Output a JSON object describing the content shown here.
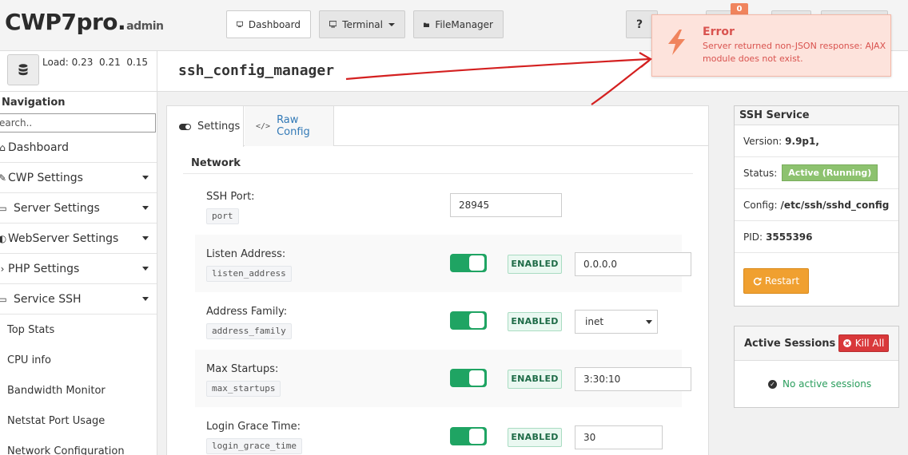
{
  "app": {
    "logo_main": "CWP7pro.",
    "logo_sub": "admin"
  },
  "topnav": {
    "dashboard": "Dashboard",
    "terminal": "Terminal",
    "filemanager": "FileManager",
    "help": "?",
    "notification_count": "0"
  },
  "header": {
    "load_label": "Load: 0.23  0.21  0.15",
    "page_title": "ssh_config_manager"
  },
  "sidebar": {
    "title": "Navigation",
    "search_placeholder": "earch..",
    "items": [
      {
        "label": "Dashboard",
        "icon": "home-icon"
      },
      {
        "label": "CWP Settings",
        "icon": "wrench-icon"
      },
      {
        "label": "Server Settings",
        "icon": "monitor-icon"
      },
      {
        "label": "WebServer Settings",
        "icon": "globe-icon"
      },
      {
        "label": "PHP Settings",
        "icon": "code-icon"
      },
      {
        "label": "Service SSH",
        "icon": "monitor-icon"
      }
    ],
    "subitems": [
      "Top Stats",
      "CPU info",
      "Bandwidth Monitor",
      "Netstat Port Usage",
      "Network Configuration"
    ]
  },
  "tabs": {
    "settings": "Settings",
    "raw_config": "Raw Config"
  },
  "network": {
    "section_title": "Network",
    "rows": [
      {
        "label": "SSH Port:",
        "key": "port",
        "value": "28945"
      },
      {
        "label": "Listen Address:",
        "key": "listen_address",
        "status": "ENABLED",
        "value": "0.0.0.0"
      },
      {
        "label": "Address Family:",
        "key": "address_family",
        "status": "ENABLED",
        "value": "inet"
      },
      {
        "label": "Max Startups:",
        "key": "max_startups",
        "status": "ENABLED",
        "value": "3:30:10"
      },
      {
        "label": "Login Grace Time:",
        "key": "login_grace_time",
        "status": "ENABLED",
        "value": "30"
      }
    ]
  },
  "ssh_service": {
    "title": "SSH Service",
    "version_label": "Version:",
    "version_value": "9.9p1,",
    "status_label": "Status:",
    "status_value": "Active (Running)",
    "config_label": "Config:",
    "config_value": "/etc/ssh/sshd_config",
    "pid_label": "PID:",
    "pid_value": "3555396",
    "restart_label": "Restart"
  },
  "sessions": {
    "title": "Active Sessions",
    "kill_label": "Kill All",
    "empty_text": "No active sessions"
  },
  "error": {
    "title": "Error",
    "message": "Server returned non-JSON response: AJAX module does not exist."
  },
  "colors": {
    "toggle_on": "#1fa463",
    "error_text": "#d9534f",
    "restart": "#f0a030",
    "kill": "#d9383a",
    "status_active": "#8dc26f"
  }
}
